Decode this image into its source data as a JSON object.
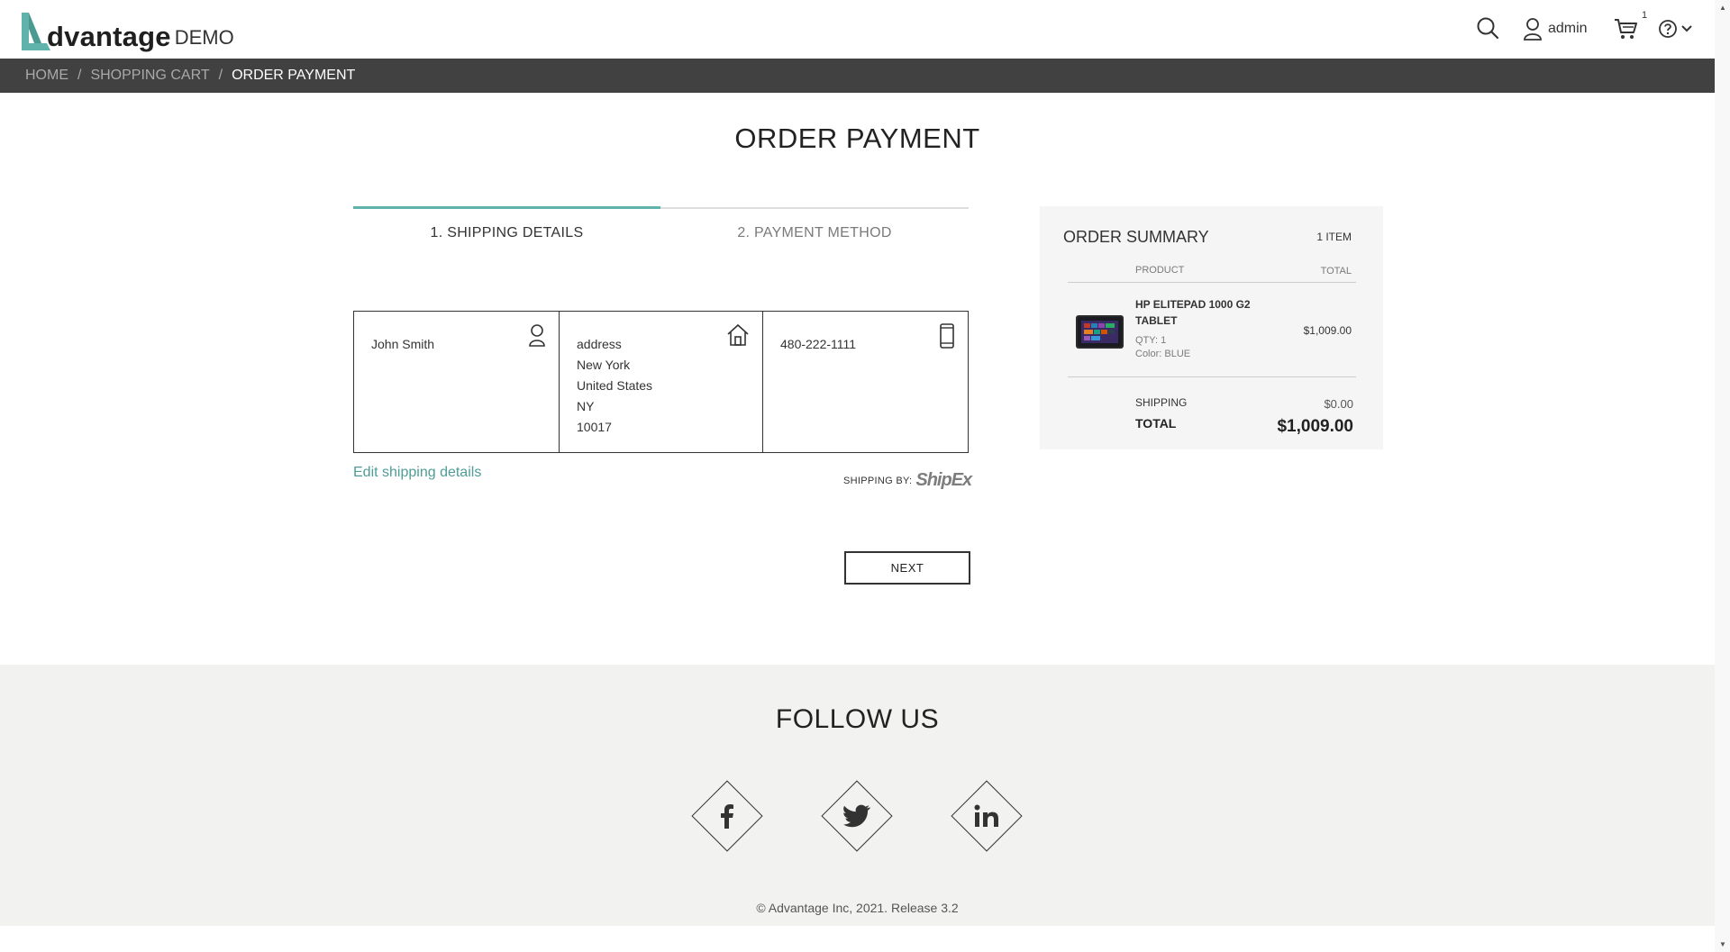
{
  "header": {
    "logo_word": "dvantage",
    "logo_demo": "DEMO",
    "user_name": "admin",
    "cart_count": "1",
    "icons": [
      "search-icon",
      "user-icon",
      "cart-icon",
      "help-icon",
      "chevron-down-icon"
    ]
  },
  "breadcrumb": {
    "items": [
      "HOME",
      "SHOPPING CART",
      "ORDER PAYMENT"
    ],
    "separator": "/"
  },
  "page_title": "ORDER PAYMENT",
  "steps": {
    "step1": "1. SHIPPING DETAILS",
    "step2": "2. PAYMENT METHOD",
    "active": 1
  },
  "shipping": {
    "name": "John Smith",
    "address_lines": [
      "address",
      "New York",
      "United States",
      "NY",
      "10017"
    ],
    "phone": "480-222-1111",
    "edit_label": "Edit shipping details",
    "shipping_by_label": "SHIPPING BY:",
    "carrier": "ShipEx"
  },
  "next_button": "NEXT",
  "order_summary": {
    "title": "ORDER SUMMARY",
    "item_count": "1 ITEM",
    "col_product": "PRODUCT",
    "col_total": "TOTAL",
    "product": {
      "name": "HP ELITEPAD 1000 G2 TABLET",
      "qty": "QTY: 1",
      "color": "Color: BLUE",
      "total": "$1,009.00"
    },
    "shipping_label": "SHIPPING",
    "shipping_value": "$0.00",
    "total_label": "TOTAL",
    "total_value": "$1,009.00"
  },
  "footer": {
    "follow_us": "FOLLOW US",
    "social": [
      "facebook-icon",
      "twitter-icon",
      "linkedin-icon"
    ],
    "copyright": "© Advantage Inc, 2021. Release 3.2"
  },
  "colors": {
    "accent": "#5fb3aa",
    "link": "#4e9d96",
    "breadcrumb_bg": "#414141",
    "footer_bg": "#f2f2f1"
  }
}
